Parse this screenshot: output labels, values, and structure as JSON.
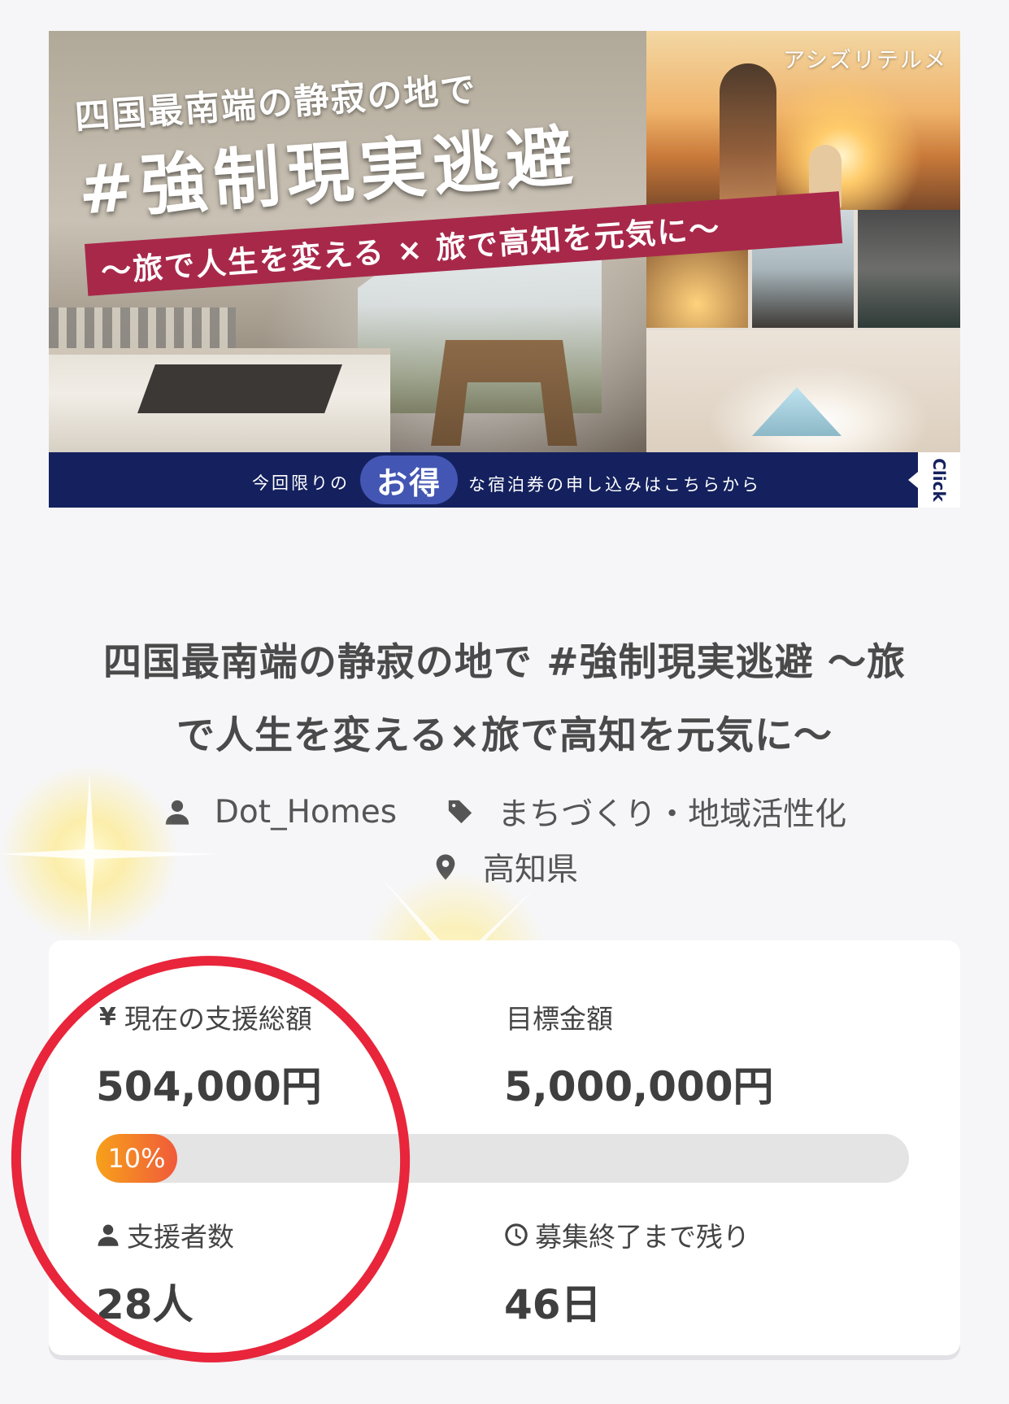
{
  "banner": {
    "brand": "アシズリテルメ",
    "title_small": "四国最南端の静寂の地で",
    "title_large": "#強制現実逃避",
    "ribbon": "〜旅で人生を変える × 旅で高知を元気に〜",
    "cta_pre": "今回限りの",
    "cta_highlight": "お得",
    "cta_post": "な宿泊券の申し込みはこちらから",
    "cta_click": "Click"
  },
  "project": {
    "title_line1": "四国最南端の静寂の地で #強制現実逃避 〜旅",
    "title_line2": "で人生を変える×旅で高知を元気に〜",
    "owner": "Dot_Homes",
    "category": "まちづくり・地域活性化",
    "location": "高知県"
  },
  "stats": {
    "current_label": "現在の支援総額",
    "current_value": "504,000円",
    "goal_label": "目標金額",
    "goal_value": "5,000,000円",
    "progress_text": "10%",
    "progress_fraction": 0.1,
    "supporters_label": "支援者数",
    "supporters_value": "28人",
    "remaining_label": "募集終了まで残り",
    "remaining_value": "46日"
  },
  "colors": {
    "highlight_circle": "#e8253b",
    "banner_navy": "#14215e",
    "banner_ribbon": "#a8284a",
    "progress_start": "#f7a11a",
    "progress_end": "#f05a3a"
  },
  "icons": [
    "user-icon",
    "tag-icon",
    "map-pin-icon",
    "yen-icon",
    "clock-icon"
  ]
}
